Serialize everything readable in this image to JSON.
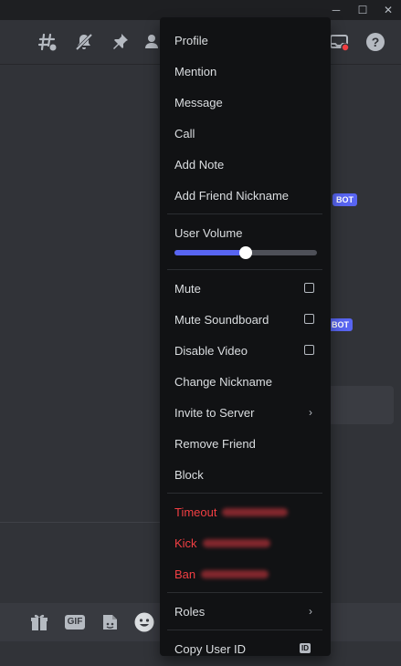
{
  "window": {
    "minimize": "─",
    "maximize": "☐",
    "close": "✕"
  },
  "header": {
    "icons": [
      "threads-icon",
      "mute-notifications-icon",
      "pin-icon",
      "member-list-icon",
      "inbox-icon",
      "help-icon"
    ],
    "help_glyph": "?"
  },
  "chat": {
    "bot_badge": "BOT"
  },
  "inputbar": {
    "gif_label": "GIF"
  },
  "menu": {
    "profile": "Profile",
    "mention": "Mention",
    "message": "Message",
    "call": "Call",
    "add_note": "Add Note",
    "add_friend_nickname": "Add Friend Nickname",
    "user_volume": "User Volume",
    "user_volume_level": 0.5,
    "mute": "Mute",
    "mute_soundboard": "Mute Soundboard",
    "disable_video": "Disable Video",
    "change_nickname": "Change Nickname",
    "invite_to_server": "Invite to Server",
    "remove_friend": "Remove Friend",
    "block": "Block",
    "timeout": "Timeout",
    "kick": "Kick",
    "ban": "Ban",
    "roles": "Roles",
    "copy_user_id": "Copy User ID",
    "id_badge": "ID",
    "chevron": "›"
  },
  "colors": {
    "accent": "#5865f2",
    "danger": "#f23f43",
    "menu_bg": "#111214",
    "app_bg": "#313338"
  }
}
